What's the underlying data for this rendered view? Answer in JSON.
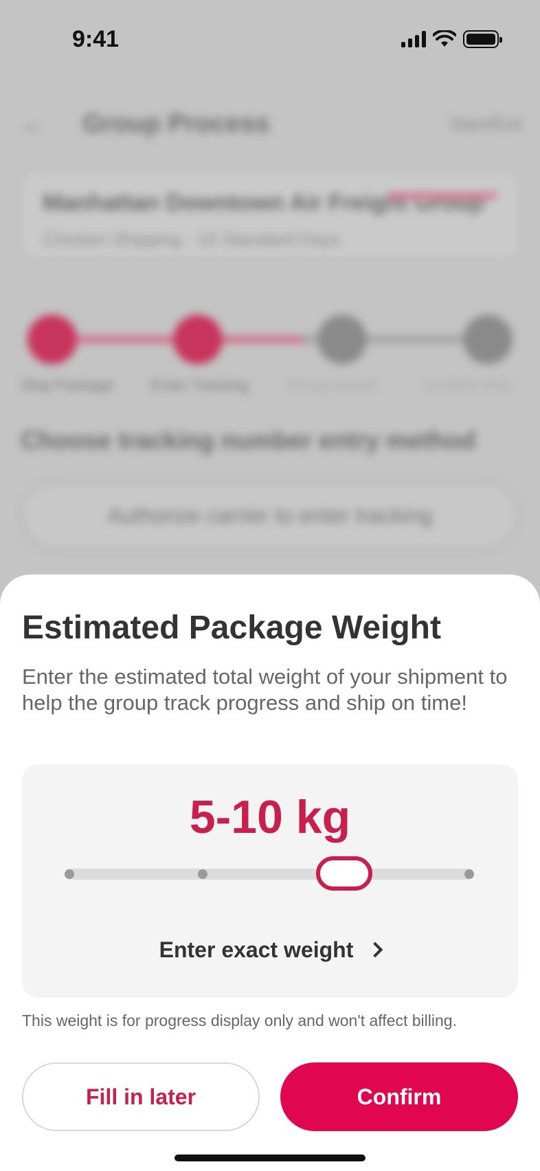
{
  "status_bar": {
    "time": "9:41"
  },
  "background": {
    "back_icon": "back-arrow-icon",
    "title": "Group Process",
    "action": "Start/Exit",
    "card": {
      "title": "Manhattan Downtown Air Freight Group",
      "subtitle": "Chicken Shipping · 10 Standard Days"
    },
    "steps": [
      {
        "label": "Ship Package",
        "state": "done"
      },
      {
        "label": "Enter Tracking",
        "state": "active"
      },
      {
        "label": "Group arrival",
        "state": "pending"
      },
      {
        "label": "Confirm ship",
        "state": "pending"
      }
    ],
    "section_title": "Choose tracking number entry method",
    "option_button": "Authorize carrier to enter tracking"
  },
  "sheet": {
    "title": "Estimated Package Weight",
    "description": "Enter the estimated total weight of your shipment to help the group track progress and ship on time!",
    "weight_value": "5-10 kg",
    "slider": {
      "stops": 4,
      "selected_index": 2,
      "accent": "#c8204e"
    },
    "exact_weight_link": "Enter exact weight",
    "note": "This weight is for progress display only and won't affect billing.",
    "fill_later_label": "Fill in later",
    "confirm_label": "Confirm",
    "confirm_color": "#e0064f"
  }
}
